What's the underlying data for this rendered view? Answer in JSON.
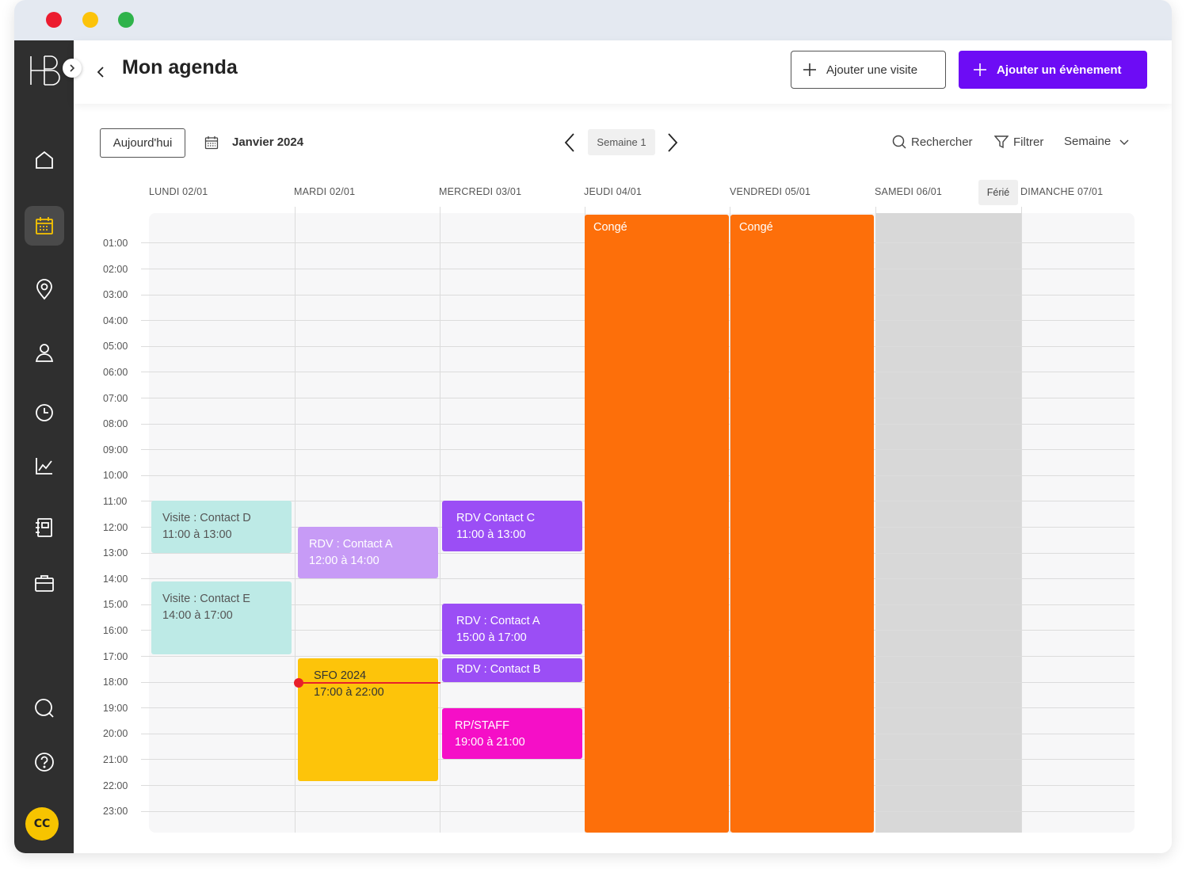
{
  "header": {
    "title": "Mon agenda",
    "add_visit_label": "Ajouter une visite",
    "add_event_label": "Ajouter un évènement"
  },
  "toolbar": {
    "today_label": "Aujourd'hui",
    "month_label": "Janvier 2024",
    "week_label": "Semaine 1",
    "search_label": "Rechercher",
    "filter_label": "Filtrer",
    "view_label": "Semaine"
  },
  "sidebar": {
    "avatar_initials": "CC"
  },
  "days": [
    "LUNDI 02/01",
    "MARDI 02/01",
    "MERCREDI 03/01",
    "JEUDI 04/01",
    "VENDREDI 05/01",
    "SAMEDI 06/01",
    "DIMANCHE 07/01"
  ],
  "holiday_badge": "Férié",
  "hours": [
    "01:00",
    "02:00",
    "03:00",
    "04:00",
    "05:00",
    "06:00",
    "07:00",
    "08:00",
    "09:00",
    "10:00",
    "11:00",
    "12:00",
    "13:00",
    "14:00",
    "15:00",
    "16:00",
    "17:00",
    "18:00",
    "19:00",
    "20:00",
    "21:00",
    "22:00",
    "23:00"
  ],
  "events": {
    "visit_d": {
      "title": "Visite : Contact D",
      "time": "11:00 à 13:00"
    },
    "visit_e": {
      "title": "Visite : Contact E",
      "time": "14:00 à 17:00"
    },
    "rdv_a_tue": {
      "title": "RDV : Contact A",
      "time": "12:00 à 14:00"
    },
    "sfo": {
      "title": "SFO 2024",
      "time": "17:00 à 22:00"
    },
    "rdv_c": {
      "title": "RDV Contact C",
      "time": "11:00 à 13:00"
    },
    "rdv_a_wed": {
      "title": "RDV : Contact A",
      "time": "15:00 à 17:00"
    },
    "rdv_b": {
      "title": "RDV  : Contact B"
    },
    "rp_staff": {
      "title": "RP/STAFF",
      "time": "19:00 à 21:00"
    },
    "conge_thu": {
      "title": "Congé"
    },
    "conge_fri": {
      "title": "Congé"
    }
  },
  "colors": {
    "primary": "#6d0cf5",
    "visit": "#bdeae6",
    "rdv_light": "#c79bf6",
    "rdv": "#9b4ef5",
    "sfo": "#fdc40a",
    "rp_staff": "#f50fc7",
    "conge": "#fd6f0a",
    "now": "#e8202a"
  }
}
